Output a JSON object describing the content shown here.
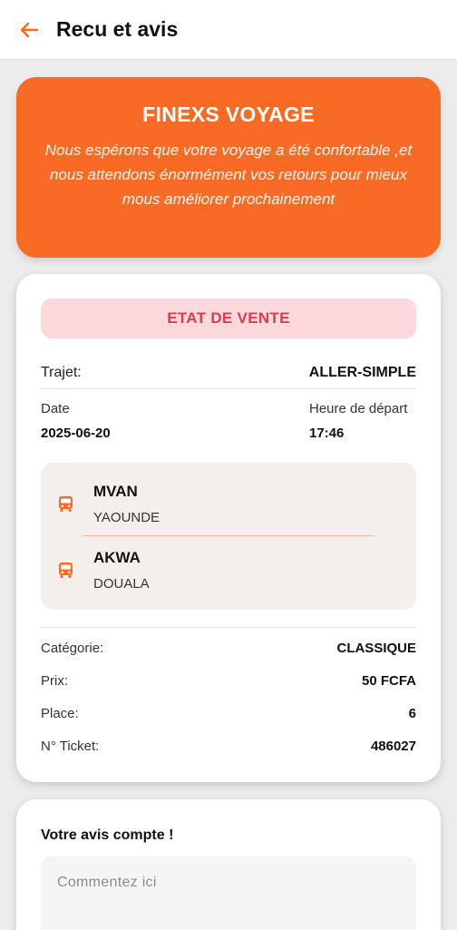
{
  "header": {
    "title": "Recu et avis",
    "back_icon": "arrow-left-icon",
    "accent_color": "#f76b24"
  },
  "hero": {
    "title": "FINEXS VOYAGE",
    "message": "Nous espérons que votre voyage a été confortable ,et nous attendons énormément vos retours pour mieux mous améliorer prochainement"
  },
  "receipt": {
    "status": "ETAT DE VENTE",
    "trajet_label": "Trajet:",
    "trajet_value": "ALLER-SIMPLE",
    "date_label": "Date",
    "date_value": "2025-06-20",
    "heure_label": "Heure de départ",
    "heure_value": "17:46",
    "departure": {
      "code": "MVAN",
      "city": "YAOUNDE",
      "icon": "bus-icon"
    },
    "arrival": {
      "code": "AKWA",
      "city": "DOUALA",
      "icon": "bus-icon"
    },
    "details": [
      {
        "label": "Catégorie:",
        "value": "CLASSIQUE"
      },
      {
        "label": "Prix:",
        "value": "50 FCFA"
      },
      {
        "label": "Place:",
        "value": "6"
      },
      {
        "label": "N° Ticket:",
        "value": "486027"
      }
    ]
  },
  "feedback": {
    "title": "Votre avis compte !",
    "placeholder": "Commentez ici"
  }
}
